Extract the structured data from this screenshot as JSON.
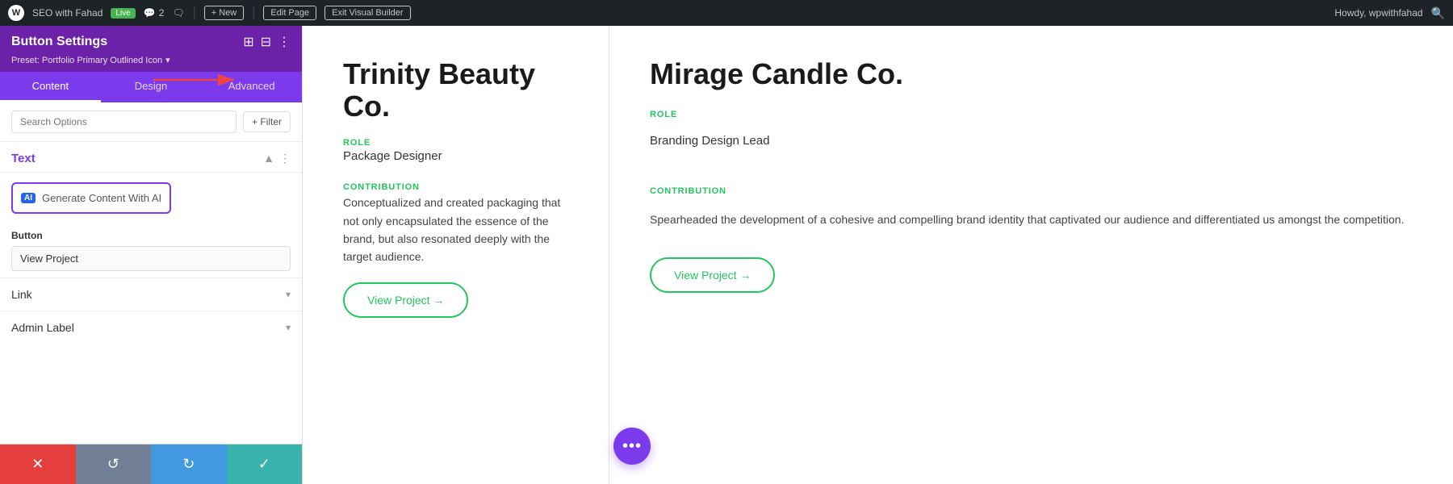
{
  "adminBar": {
    "wpLogo": "W",
    "siteName": "SEO with Fahad",
    "liveBadge": "Live",
    "commentCount": "2",
    "plusNew": "+ New",
    "editPage": "Edit Page",
    "exitBuilder": "Exit Visual Builder",
    "howdy": "Howdy, wpwithfahad"
  },
  "panel": {
    "title": "Button Settings",
    "preset": "Preset: Portfolio Primary Outlined Icon",
    "tabs": [
      "Content",
      "Design",
      "Advanced"
    ],
    "activeTab": "Content",
    "searchPlaceholder": "Search Options",
    "filterLabel": "+ Filter",
    "textSection": {
      "label": "Text",
      "aiButton": "Generate Content With AI",
      "aiIconLabel": "AI"
    },
    "buttonSection": {
      "label": "Button",
      "value": "View Project"
    },
    "linkSection": {
      "label": "Link"
    },
    "adminLabelSection": {
      "label": "Admin Label"
    },
    "footer": {
      "cancel": "✕",
      "undo": "↺",
      "redo": "↻",
      "save": "✓"
    }
  },
  "cards": [
    {
      "company": "Trinity Beauty Co.",
      "roleLabel": "ROLE",
      "roleValue": "Package Designer",
      "contributionLabel": "CONTRIBUTION",
      "contributionText": "Conceptualized and created packaging that not only encapsulated the essence of the brand, but also resonated deeply with the target audience.",
      "viewProjectBtn": "View Project →"
    },
    {
      "company": "Mirage Candle Co.",
      "roleLabel": "ROLE",
      "roleValue": "Branding Design Lead",
      "contributionLabel": "CONTRIBUTION",
      "contributionText": "Spearheaded the development of a cohesive and compelling brand identity that captivated our audience and differentiated us amongst the competition.",
      "viewProjectBtn": "View Project →"
    }
  ],
  "fab": {
    "dots": "•••"
  }
}
